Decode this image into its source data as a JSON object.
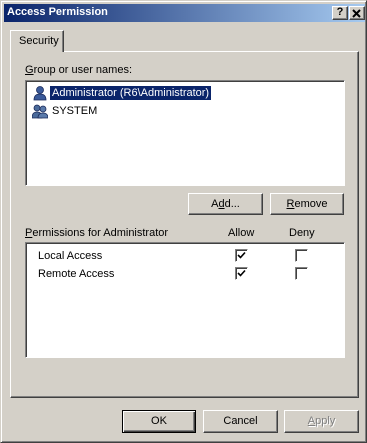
{
  "window": {
    "title": "Access Permission",
    "help_label": "?",
    "close_label": "✕"
  },
  "tabs": [
    {
      "label": "Security",
      "selected": true
    }
  ],
  "users_section": {
    "label_accel": "G",
    "label_rest": "roup or user names:",
    "users": [
      {
        "name": "Administrator (R6\\Administrator)",
        "icon": "user-icon",
        "selected": true
      },
      {
        "name": "SYSTEM",
        "icon": "users-group-icon",
        "selected": false
      }
    ],
    "add_button": {
      "pre": "A",
      "accel": "d",
      "post": "d..."
    },
    "remove_button": {
      "accel": "R",
      "post": "emove"
    }
  },
  "permissions_section": {
    "label_accel": "P",
    "label_rest": "ermissions for Administrator",
    "allow_header": "Allow",
    "deny_header": "Deny",
    "rows": [
      {
        "name": "Local Access",
        "allow": true,
        "deny": false
      },
      {
        "name": "Remote Access",
        "allow": true,
        "deny": false
      }
    ]
  },
  "footer": {
    "ok_label": "OK",
    "cancel_label": "Cancel",
    "apply_accel": "A",
    "apply_post": "pply"
  },
  "colors": {
    "title_gradient_start": "#0a246a",
    "title_gradient_end": "#a6caf0",
    "selection": "#0a246a",
    "face": "#d4d0c8"
  }
}
